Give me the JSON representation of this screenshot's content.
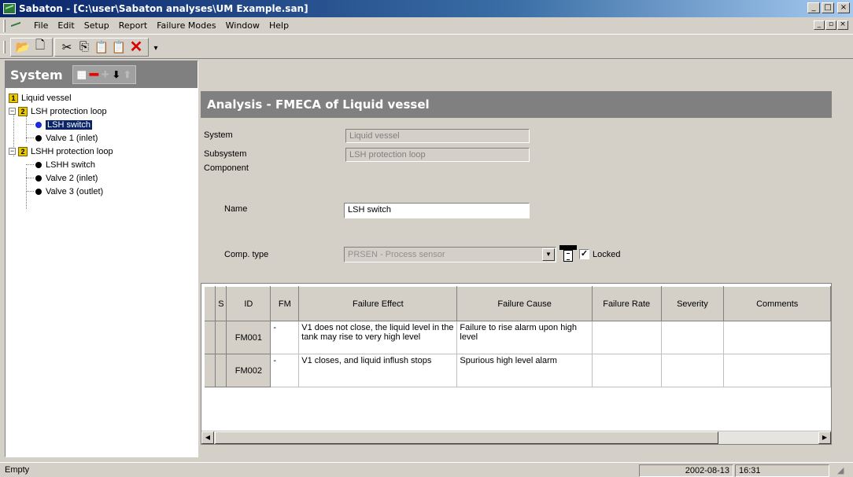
{
  "window": {
    "title": "Sabaton - [C:\\user\\Sabaton analyses\\UM Example.san]"
  },
  "menu": [
    "File",
    "Edit",
    "Setup",
    "Report",
    "Failure Modes",
    "Window",
    "Help"
  ],
  "toolbar": {
    "icons": [
      "open-folder-icon",
      "new-document-icon",
      "cut-icon",
      "copy-icon",
      "paste-icon",
      "paste-special-icon",
      "delete-icon"
    ]
  },
  "system_pane": {
    "title": "System",
    "tree": {
      "root": {
        "badge": "1",
        "label": "Liquid vessel"
      },
      "groups": [
        {
          "badge": "2",
          "label": "LSH protection loop",
          "children": [
            "LSH switch",
            "Valve 1 (inlet)"
          ]
        },
        {
          "badge": "2",
          "label": "LSHH protection loop",
          "children": [
            "LSHH switch",
            "Valve 2 (inlet)",
            "Valve 3 (outlet)"
          ]
        }
      ],
      "selected": "LSH switch"
    }
  },
  "analysis": {
    "title": "Analysis - FMECA of Liquid vessel",
    "system_label": "System",
    "system_value": "Liquid vessel",
    "subsystem_label": "Subsystem",
    "subsystem_value": "LSH protection loop",
    "component_label": "Component",
    "name_label": "Name",
    "name_value": "LSH switch",
    "comp_type_label": "Comp. type",
    "comp_type_value": "PRSEN - Process sensor",
    "locked_label": "Locked",
    "locked": true
  },
  "grid": {
    "columns": [
      "S",
      "ID",
      "FM",
      "Failure Effect",
      "Failure Cause",
      "Failure Rate",
      "Severity",
      "Comments"
    ],
    "rows": [
      {
        "s": "",
        "id": "FM001",
        "fm": "-",
        "effect": "V1 does not close, the liquid level in the tank may rise to very high level",
        "cause": "Failure to rise alarm upon high level",
        "rate": "",
        "severity": "",
        "comments": ""
      },
      {
        "s": "",
        "id": "FM002",
        "fm": "-",
        "effect": "V1 closes, and liquid inflush stops",
        "cause": "Spurious high level alarm",
        "rate": "",
        "severity": "",
        "comments": ""
      }
    ]
  },
  "status": {
    "message": "Empty",
    "date": "2002-08-13",
    "time": "16:31"
  }
}
